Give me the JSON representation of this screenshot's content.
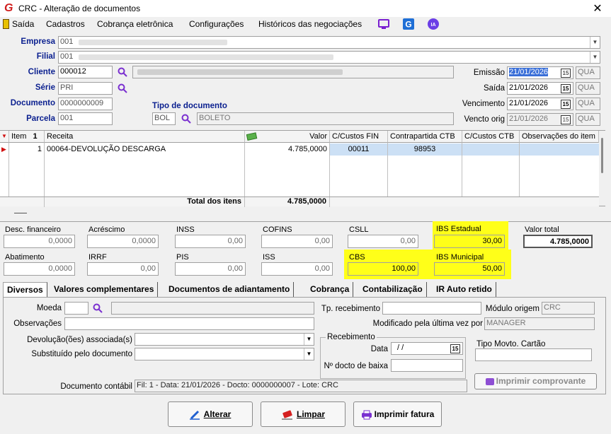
{
  "window": {
    "title": "CRC - Alteração de documentos",
    "close": "✕"
  },
  "menu": {
    "items": [
      "Saída",
      "Cadastros",
      "Cobrança eletrônica",
      "Configurações",
      "Históricos das negociações"
    ]
  },
  "header": {
    "empresa_label": "Empresa",
    "empresa_code": "001",
    "filial_label": "Filial",
    "filial_code": "001",
    "cliente_label": "Cliente",
    "cliente_code": "000012",
    "serie_label": "Série",
    "serie_value": "PRI",
    "documento_label": "Documento",
    "documento_value": "0000000009",
    "parcela_label": "Parcela",
    "parcela_value": "001",
    "tipo_doc_label": "Tipo de documento",
    "tipo_doc_code": "BOL",
    "tipo_doc_name": "BOLETO",
    "emissao_label": "Emissão",
    "emissao_date": "21/01/2026",
    "emissao_day": "QUA",
    "saida_label": "Saída",
    "saida_date": "21/01/2026",
    "saida_day": "QUA",
    "vencimento_label": "Vencimento",
    "vencimento_date": "21/01/2026",
    "vencimento_day": "QUA",
    "vencto_orig_label": "Vencto orig",
    "vencto_orig_date": "21/01/2026",
    "vencto_orig_day": "QUA"
  },
  "grid": {
    "columns": [
      "Item",
      "Receita",
      "Valor",
      "C/Custos FIN",
      "Contrapartida CTB",
      "C/Custos CTB",
      "Observações do item"
    ],
    "sort_indicator": "1",
    "rows": [
      {
        "item": "1",
        "receita": "00064-DEVOLUÇÃO  DESCARGA",
        "valor": "4.785,0000",
        "ccustos_fin": "00011",
        "contrapartida": "98953",
        "ccustos_ctb": "",
        "obs": ""
      }
    ],
    "total_label": "Total dos itens",
    "total_value": "4.785,0000"
  },
  "taxes": {
    "desc_fin_label": "Desc. financeiro",
    "desc_fin": "0,0000",
    "acrescimo_label": "Acréscimo",
    "acrescimo": "0,0000",
    "inss_label": "INSS",
    "inss": "0,00",
    "cofins_label": "COFINS",
    "cofins": "0,00",
    "csll_label": "CSLL",
    "csll": "0,00",
    "ibs_est_label": "IBS Estadual",
    "ibs_est": "30,00",
    "valor_total_label": "Valor total",
    "valor_total": "4.785,0000",
    "abatimento_label": "Abatimento",
    "abatimento": "0,0000",
    "irrf_label": "IRRF",
    "irrf": "0,00",
    "pis_label": "PIS",
    "pis": "0,00",
    "iss_label": "ISS",
    "iss": "0,00",
    "cbs_label": "CBS",
    "cbs": "100,00",
    "ibs_mun_label": "IBS Municipal",
    "ibs_mun": "50,00"
  },
  "tabs": [
    "Diversos",
    "Valores complementares",
    "Documentos de adiantamento",
    "Cobrança",
    "Contabilização",
    "IR Auto retido"
  ],
  "diversos": {
    "moeda_label": "Moeda",
    "observacoes_label": "Observações",
    "devolucoes_label": "Devolução(ões) associada(s)",
    "substituido_label": "Substituído pelo documento",
    "tp_recebimento_label": "Tp. recebimento",
    "modulo_origem_label": "Módulo origem",
    "modulo_origem": "CRC",
    "modificado_label": "Modificado pela última vez por",
    "modificado": "MANAGER",
    "recebimento_group": "Recebimento",
    "data_label": "Data",
    "data_value": "/  /",
    "docto_baixa_label": "Nº docto de baixa",
    "tipo_movto_label": "Tipo Movto. Cartão",
    "imprimir_comprovante": "Imprimir comprovante",
    "doc_contabil_label": "Documento contábil",
    "doc_contabil": "Fil: 1 - Data: 21/01/2026 - Docto: 0000000007 - Lote: CRC"
  },
  "buttons": {
    "alterar": "Alterar",
    "limpar": "Limpar",
    "imprimir_fatura": "Imprimir fatura"
  },
  "colors": {
    "label_blue": "#0a1f8f",
    "highlight_yellow": "#ffff19",
    "selected_row": "#cce0f5",
    "date_selected": "#3a6fd8"
  }
}
